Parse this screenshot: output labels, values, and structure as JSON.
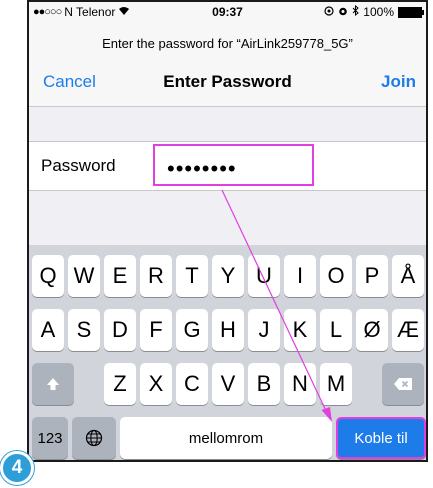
{
  "status": {
    "carrier": "N Telenor",
    "time": "09:37",
    "battery": "100%"
  },
  "prompt": "Enter the password for “AirLink259778_5G”",
  "nav": {
    "cancel": "Cancel",
    "title": "Enter Password",
    "join": "Join"
  },
  "password": {
    "label": "Password",
    "value": "••••••••"
  },
  "keyboard": {
    "row1": [
      "Q",
      "W",
      "E",
      "R",
      "T",
      "Y",
      "U",
      "I",
      "O",
      "P",
      "Å"
    ],
    "row2": [
      "A",
      "S",
      "D",
      "F",
      "G",
      "H",
      "J",
      "K",
      "L",
      "Ø",
      "Æ"
    ],
    "row3": [
      "Z",
      "X",
      "C",
      "V",
      "B",
      "N",
      "M"
    ],
    "numbers_key": "123",
    "space_key": "mellomrom",
    "go_key": "Koble til"
  },
  "step_badge": "4",
  "colors": {
    "accent": "#1d7ce8",
    "highlight": "#e040e0",
    "badge": "#2e9ed8"
  }
}
